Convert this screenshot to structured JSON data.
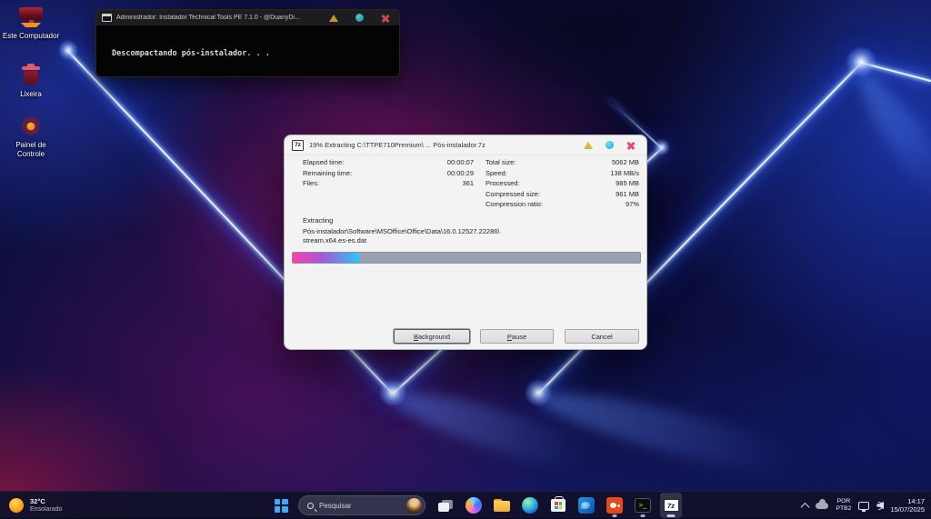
{
  "desktop_icons": [
    {
      "label": "Este Computador"
    },
    {
      "label": "Lixeira"
    },
    {
      "label": "Painel de Controle"
    }
  ],
  "console": {
    "title": "Administrador: Instalador Technical Tools PE 7.1.0 - @DuanyDi...",
    "body_text": "Descompactando pós-instalador. . ."
  },
  "dialog": {
    "icon_label": "7z",
    "title": "19% Extracting C:\\TTPE710Premium\\ ... Pós-instalador.7z",
    "stats_left": [
      {
        "label": "Elapsed time:",
        "value": "00:00:07"
      },
      {
        "label": "Remaining time:",
        "value": "00:00:29"
      },
      {
        "label": "Files:",
        "value": "361"
      }
    ],
    "stats_right": [
      {
        "label": "Total size:",
        "value": "5062 MB"
      },
      {
        "label": "Speed:",
        "value": "138 MB/s"
      },
      {
        "label": "Processed:",
        "value": "985 MB"
      },
      {
        "label": "Compressed size:",
        "value": "961 MB"
      },
      {
        "label": "Compression ratio:",
        "value": "97%"
      }
    ],
    "section_label": "Extracting",
    "path_line1": "Pós-instalador\\Software\\MSOffice\\Office\\Data\\16.0.12527.22286\\",
    "path_line2": "stream.x64.es-es.dat",
    "progress_percent": 19,
    "buttons": [
      {
        "u": "B",
        "rest": "ackground"
      },
      {
        "u": "P",
        "rest": "ause"
      },
      {
        "u": "",
        "rest": "Cancel"
      }
    ]
  },
  "taskbar": {
    "weather_temp": "32°C",
    "weather_condition": "Ensolarado",
    "search_label": "Pesquisar",
    "seven_zip_badge": "7z",
    "terminal_glyph": ">_",
    "apps": [
      "task-view",
      "copilot",
      "file-explorer",
      "edge",
      "microsoft-store",
      "blue-app",
      "installer-app",
      "terminal",
      "7-zip"
    ],
    "tray": {
      "lang_top": "POR",
      "lang_bottom": "PTB2",
      "time": "14:17",
      "date": "15/07/2025"
    }
  },
  "colors": {
    "minimize_button": "#dfb23a",
    "maximize_button": "#38c4e8",
    "close_button": "#e8486e",
    "progress_fill_start": "#ff3fa8",
    "progress_fill_end": "#28c8f8",
    "progress_track": "#9aa0b0"
  }
}
